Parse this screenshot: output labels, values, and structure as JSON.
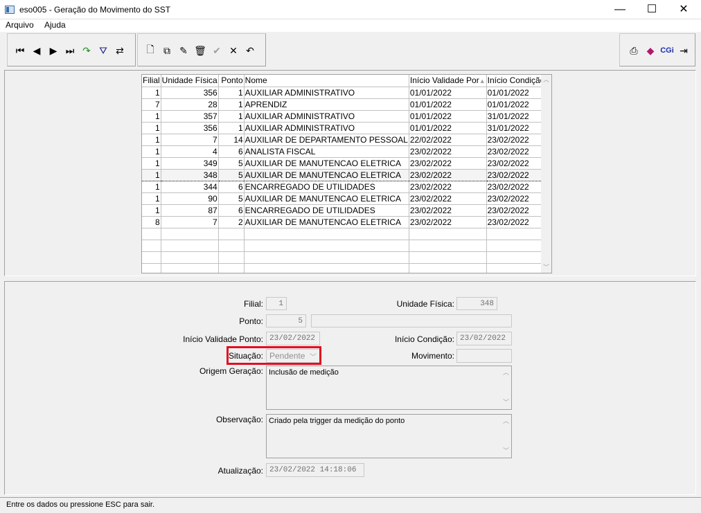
{
  "window": {
    "title": "eso005 - Geração do Movimento do SST",
    "minimize": "—",
    "maximize": "☐",
    "close": "✕"
  },
  "menu": [
    "Arquivo",
    "Ajuda"
  ],
  "toolbar": {
    "nav": [
      {
        "name": "first-record-icon",
        "glyph": "⏮"
      },
      {
        "name": "previous-record-icon",
        "glyph": "◀"
      },
      {
        "name": "next-record-icon",
        "glyph": "▶"
      },
      {
        "name": "last-record-icon",
        "glyph": "⏭"
      },
      {
        "name": "refresh-icon",
        "glyph": "↷"
      },
      {
        "name": "filter-icon",
        "glyph": "⛛"
      },
      {
        "name": "handshake-icon",
        "glyph": "⇄"
      }
    ],
    "edit": [
      {
        "name": "new-document-icon",
        "glyph": "🗋"
      },
      {
        "name": "copy-icon",
        "glyph": "⧉"
      },
      {
        "name": "edit-icon",
        "glyph": "✎"
      },
      {
        "name": "delete-icon",
        "glyph": "🗑"
      },
      {
        "name": "confirm-icon",
        "glyph": "✔"
      },
      {
        "name": "cancel-icon",
        "glyph": "✕"
      },
      {
        "name": "undo-icon",
        "glyph": "↶"
      }
    ],
    "right": [
      {
        "name": "print-icon",
        "glyph": "⎙"
      },
      {
        "name": "book-icon",
        "glyph": "◆"
      },
      {
        "name": "cgi-icon",
        "glyph": "CGi"
      },
      {
        "name": "exit-icon",
        "glyph": "⇥"
      }
    ]
  },
  "grid": {
    "columns": [
      "Filial",
      "Unidade Física",
      "Ponto",
      "Nome",
      "Início Validade Por",
      "Início Condição"
    ],
    "sort_indicator": "▲",
    "rows": [
      [
        "1",
        "356",
        "1",
        "AUXILIAR ADMINISTRATIVO",
        "01/01/2022",
        "01/01/2022"
      ],
      [
        "7",
        "28",
        "1",
        "APRENDIZ",
        "01/01/2022",
        "01/01/2022"
      ],
      [
        "1",
        "357",
        "1",
        "AUXILIAR ADMINISTRATIVO",
        "01/01/2022",
        "31/01/2022"
      ],
      [
        "1",
        "356",
        "1",
        "AUXILIAR ADMINISTRATIVO",
        "01/01/2022",
        "31/01/2022"
      ],
      [
        "1",
        "7",
        "14",
        "AUXILIAR DE DEPARTAMENTO PESSOAL",
        "22/02/2022",
        "23/02/2022"
      ],
      [
        "1",
        "4",
        "6",
        "ANALISTA FISCAL",
        "23/02/2022",
        "23/02/2022"
      ],
      [
        "1",
        "349",
        "5",
        "AUXILIAR DE MANUTENCAO ELETRICA",
        "23/02/2022",
        "23/02/2022"
      ],
      [
        "1",
        "348",
        "5",
        "AUXILIAR DE MANUTENCAO ELETRICA",
        "23/02/2022",
        "23/02/2022"
      ],
      [
        "1",
        "344",
        "6",
        "ENCARREGADO DE UTILIDADES",
        "23/02/2022",
        "23/02/2022"
      ],
      [
        "1",
        "90",
        "5",
        "AUXILIAR DE MANUTENCAO ELETRICA",
        "23/02/2022",
        "23/02/2022"
      ],
      [
        "1",
        "87",
        "6",
        "ENCARREGADO DE UTILIDADES",
        "23/02/2022",
        "23/02/2022"
      ],
      [
        "8",
        "7",
        "2",
        "AUXILIAR DE MANUTENCAO ELETRICA",
        "23/02/2022",
        "23/02/2022"
      ]
    ],
    "selected_row": 7,
    "empty_rows": 4
  },
  "form": {
    "filial_label": "Filial:",
    "filial_value": "1",
    "unidade_label": "Unidade Física:",
    "unidade_value": "348",
    "ponto_label": "Ponto:",
    "ponto_value": "5",
    "ponto_desc": "",
    "inicio_validade_label": "Início Validade Ponto:",
    "inicio_validade_value": "23/02/2022",
    "inicio_condicao_label": "Início Condição:",
    "inicio_condicao_value": "23/02/2022",
    "situacao_label": "Situação:",
    "situacao_value": "Pendente",
    "movimento_label": "Movimento:",
    "movimento_value": "",
    "origem_label": "Origem Geração:",
    "origem_value": "Inclusão de medição",
    "observacao_label": "Observação:",
    "observacao_value": "Criado pela trigger da medição do ponto",
    "atualizacao_label": "Atualização:",
    "atualizacao_value": "23/02/2022 14:18:06"
  },
  "status": "Entre os dados ou pressione ESC para sair.",
  "colors": {
    "highlight": "#e0101f"
  }
}
